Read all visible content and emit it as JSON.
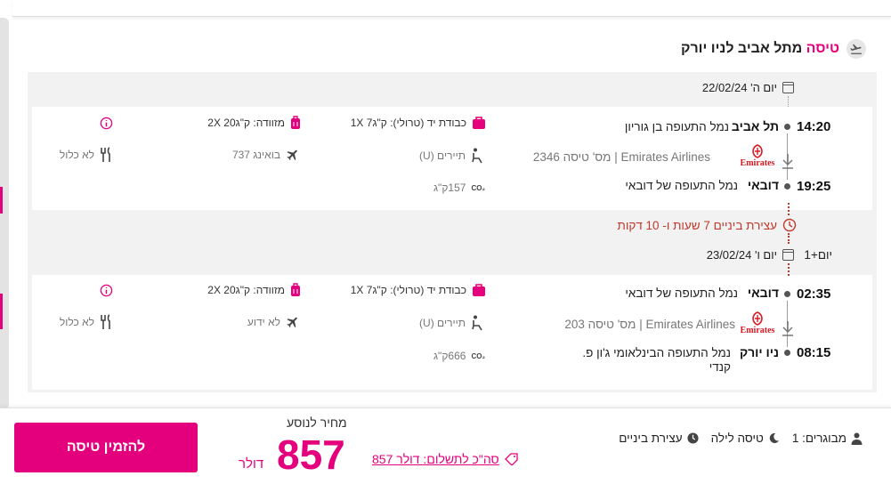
{
  "header": {
    "title_pink": "טיסה",
    "title_rest": "מתל אביב לניו יורק"
  },
  "leg1": {
    "date": "יום ה' 22/02/24",
    "dep_time": "14:20",
    "dep_city": "תל אביב",
    "dep_airport": "נמל התעופה בן גוריון",
    "airline_line": "Emirates Airlines | מס' טיסה 2346",
    "arr_time": "19:25",
    "arr_city": "דובאי",
    "arr_airport": "נמל התעופה של דובאי",
    "carry_on": "כבודת יד (טרולי): ק\"ג7 1X",
    "luggage": "מזוודה: ק\"ג20 2X",
    "seat": "תיירים (U)",
    "aircraft": "בואינג 737",
    "meal": "לא כלול",
    "co2": "157ק\"ג"
  },
  "stopover": {
    "text": "עצירת ביניים 7 שעות ו- 10 דקות",
    "next_day": "יום+1",
    "date": "יום ו' 23/02/24"
  },
  "leg2": {
    "dep_time": "02:35",
    "dep_city": "דובאי",
    "dep_airport": "נמל התעופה של דובאי",
    "airline_line": "Emirates Airlines | מס' טיסה 203",
    "arr_time": "08:15",
    "arr_city": "ניו יורק",
    "arr_airport_1": "נמל התעופה הבינלאומי ג'ון פ.",
    "arr_airport_2": "קנדי",
    "carry_on": "כבודת יד (טרולי): ק\"ג7 1X",
    "luggage": "מזוודה: ק\"ג20 2X",
    "seat": "תיירים (U)",
    "aircraft": "לא ידוע",
    "meal": "לא כלול",
    "co2": "666ק\"ג"
  },
  "airline_logo_text": "Emirates",
  "footer": {
    "passengers": "מבוגרים: 1",
    "night_flight": "טיסה לילה",
    "stopover": "עצירת ביניים",
    "price_label": "מחיר לנוסע",
    "price": "857",
    "currency": "דולר",
    "total": "סה\"כ לתשלום: דולר 857",
    "book_button": "להזמין טיסה"
  },
  "colors": {
    "brand": "#e4007c",
    "stopover": "#c0392b",
    "emirates": "#d71921"
  }
}
